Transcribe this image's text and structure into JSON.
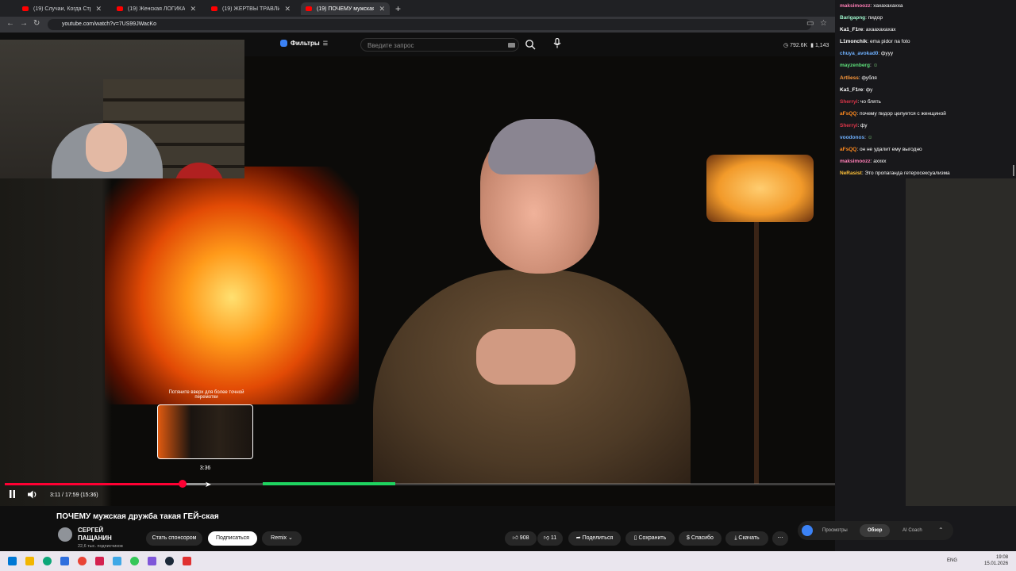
{
  "browser": {
    "tabs": [
      {
        "label": "(19) Случаи, Когда Стримерам..."
      },
      {
        "label": "(19) Женская ЛОГИКА не пер..."
      },
      {
        "label": "(19) ЖЕРТВЫ ТРАВЛИ - Что с..."
      },
      {
        "label": "(19) ПОЧЕМУ мужская др..."
      }
    ],
    "url": "youtube.com/watch?v=7US99JWacKo"
  },
  "youtube": {
    "filters_label": "Фильтры",
    "search_placeholder": "Введите запрос",
    "stats_views": "792.6K",
    "stats_count": "1,143"
  },
  "player": {
    "seek_hint": "Потяните вверх для более точной перемотки",
    "preview_time": "3:36",
    "time_display": "3:11 / 17:59 (15:36)",
    "progress_fraction": 0.177,
    "buffer_fraction": 0.2
  },
  "video_info": {
    "title": "ПОЧЕМУ мужская дружба такая ГЕЙ-ская",
    "channel_line1": "СЕРГЕЙ",
    "channel_line2": "ПАЩАНИН",
    "subscribers": "22,6 тыс. подписчиков",
    "sponsor_label": "Стать спонсором",
    "subscribe_label": "Подписаться",
    "remix_label": "Remix",
    "likes": "908",
    "dislikes": "11",
    "share_label": "Поделиться",
    "save_label": "Сохранить",
    "thanks_label": "Спасибо",
    "download_label": "Скачать"
  },
  "panel_tabs": [
    "Просмотры",
    "Обзор",
    "AI Coach"
  ],
  "chat": [
    {
      "user": "maksimoozz",
      "color": "#ff7eb6",
      "text": "хахахахахха"
    },
    {
      "user": "Barigapng",
      "color": "#9cf0c8",
      "text": "пидор"
    },
    {
      "user": "Ka1_F1re",
      "color": "#ffffff",
      "text": "ахаахахахах"
    },
    {
      "user": "L1monchik",
      "color": "#ffffff",
      "text": "ema pidor na foto"
    },
    {
      "user": "chuya_avokad0",
      "color": "#6fb1ff",
      "text": "фууу"
    },
    {
      "user": "mayzenberg",
      "color": "#5de07a",
      "text": ""
    },
    {
      "user": "Artliess",
      "color": "#ff9a3c",
      "text": "фубля"
    },
    {
      "user": "Ka1_F1re",
      "color": "#ffffff",
      "text": "фу"
    },
    {
      "user": "Sherryi",
      "color": "#e0364a",
      "text": "чо блять"
    },
    {
      "user": "aFsQQ",
      "color": "#ff8a1f",
      "text": "почему пидор целуется с женщиной"
    },
    {
      "user": "Sherryi",
      "color": "#e0364a",
      "text": "фу"
    },
    {
      "user": "voodonos",
      "color": "#6fb1ff",
      "text": ""
    },
    {
      "user": "aFsQQ",
      "color": "#ff8a1f",
      "text": "он не удалит ему выгодно"
    },
    {
      "user": "maksimoozz",
      "color": "#ff7eb6",
      "text": "аххкх"
    },
    {
      "user": "NeRasist",
      "color": "#ffc23a",
      "text": "Это пропаганда гетеросексуализма"
    }
  ],
  "taskbar": {
    "lang": "ENG",
    "time": "19:08",
    "date": "15.01.2026"
  }
}
